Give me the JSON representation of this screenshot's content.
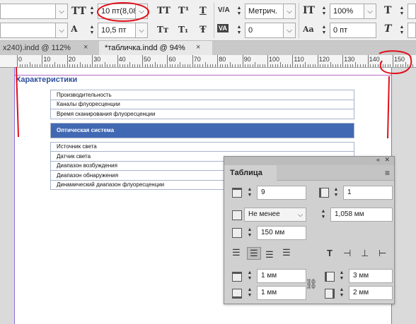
{
  "control_bar": {
    "font_size": "10 пт(8,08",
    "leading": "10,5 пт",
    "kerning": "Метрич.",
    "tracking": "0",
    "vertical_scale": "100%",
    "baseline_shift": "0 пт",
    "icons": {
      "font_size_icon": "ТТ",
      "leading_icon": "А",
      "all_caps": "TT",
      "superscript": "T¹",
      "underline": "T",
      "small_caps": "Tт",
      "subscript": "T₁",
      "strikethrough": "Ŧ",
      "kerning_icon": "V/A",
      "tracking_icon": "VA",
      "vscale_icon": "IT",
      "baseline_icon": "Aa",
      "hscale_icon": "T",
      "skew_icon": "T"
    }
  },
  "tabs": [
    {
      "label": "x240).indd @ 112%",
      "close": "×"
    },
    {
      "label": "*табличка.indd @ 94%",
      "close": "×"
    }
  ],
  "ruler": {
    "labels": [
      "0",
      "10",
      "20",
      "30",
      "40",
      "50",
      "60",
      "70",
      "80",
      "90",
      "100",
      "110",
      "120",
      "130",
      "140",
      "150"
    ]
  },
  "document": {
    "heading": "Характеристики",
    "table_rows": [
      "Производительность",
      "Каналы флуоресценции",
      "Время сканирования флуоресценции"
    ],
    "section_header": "Оптическая система",
    "table_rows_2": [
      "Источник света",
      "Датчик света",
      "Диапазон возбуждения",
      "Диапазон обнаружения",
      "Динамический диапазон флуоресценции"
    ]
  },
  "table_panel": {
    "title": "Таблица",
    "rows": "9",
    "columns": "1",
    "row_height_mode": "Не менее",
    "row_height": "1,058 мм",
    "column_width": "150 мм",
    "inset_top": "1 мм",
    "inset_bottom": "1 мм",
    "inset_left": "3 мм",
    "inset_right": "2 мм"
  },
  "colors": {
    "accent_blue": "#4169b3",
    "heading_blue": "#2e4f9b",
    "annotation_red": "#e0101b"
  }
}
